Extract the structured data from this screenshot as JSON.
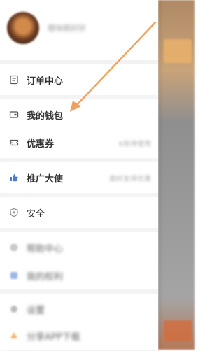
{
  "drawer": {
    "profile": {
      "username": "橙味糕好好",
      "avatar": "avatar-image"
    },
    "items": [
      {
        "label": "订单中心",
        "icon": "order-icon",
        "extra": ""
      },
      {
        "label": "我的钱包",
        "icon": "wallet-icon",
        "extra": ""
      },
      {
        "label": "优惠券",
        "icon": "coupon-icon",
        "extra": "6张待使用"
      },
      {
        "label": "推广大使",
        "icon": "thumbs-up-icon",
        "extra": "邀好友得优惠"
      },
      {
        "label": "安全",
        "icon": "shield-icon",
        "extra": ""
      },
      {
        "label": "帮助中心",
        "icon": "help-icon",
        "extra": ""
      },
      {
        "label": "我的权利",
        "icon": "rights-icon",
        "extra": ""
      },
      {
        "label": "设置",
        "icon": "gear-icon",
        "extra": ""
      },
      {
        "label": "分享APP下载",
        "icon": "share-icon",
        "extra": ""
      }
    ]
  },
  "colors": {
    "accent_arrow": "#f2a15c",
    "icon_stroke": "#555555",
    "text_primary": "#333333"
  }
}
